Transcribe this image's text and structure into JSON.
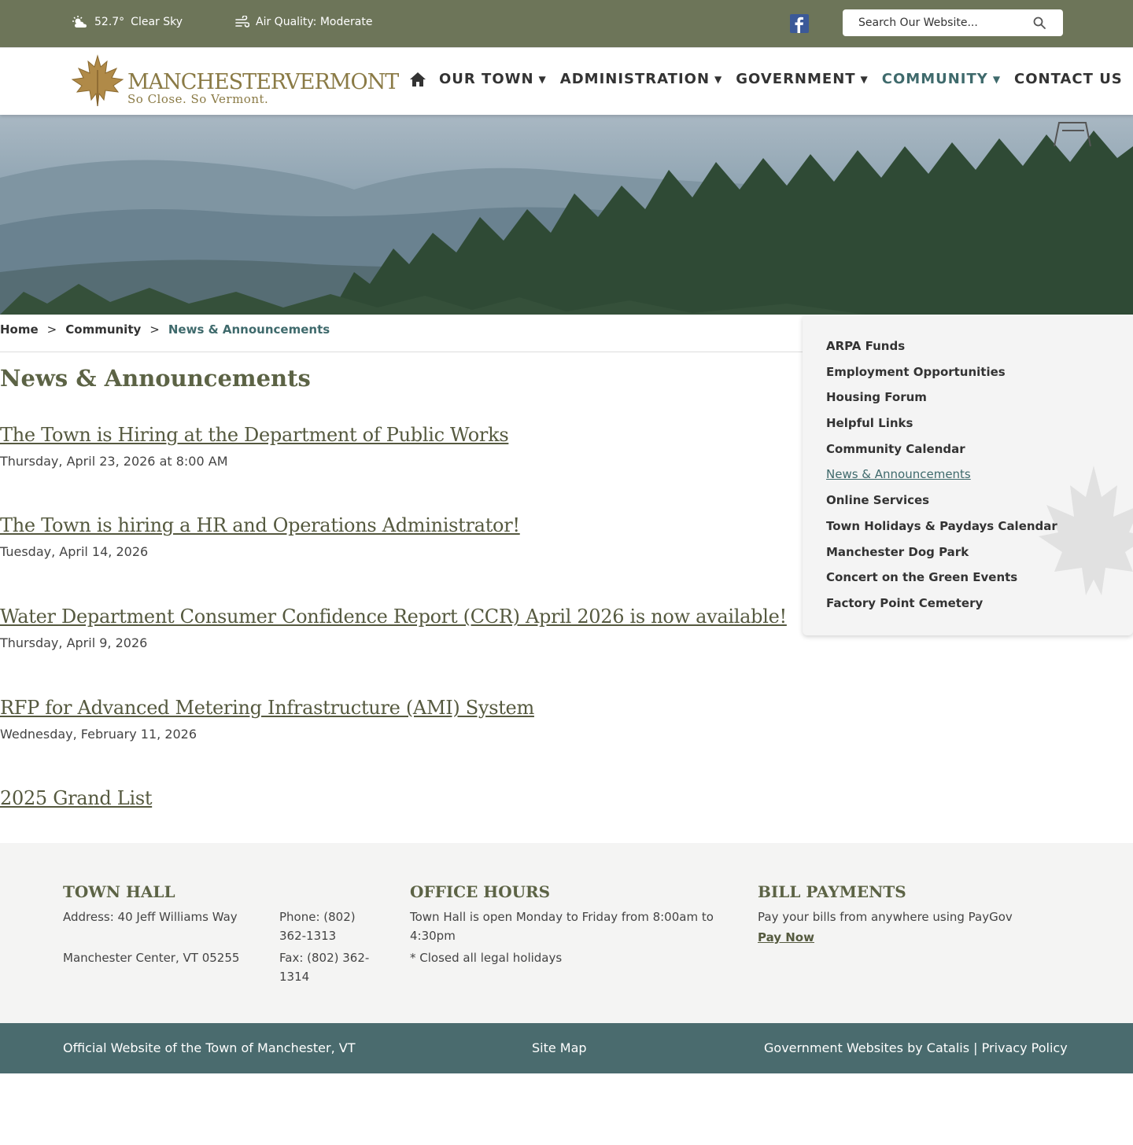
{
  "topbar": {
    "temperature": "52.7°",
    "condition": "Clear Sky",
    "air_quality": "Air Quality: Moderate",
    "search_placeholder": "Search Our Website..."
  },
  "header": {
    "logo_name": "MANCHESTERVERMONT",
    "logo_tagline": "So Close. So Vermont.",
    "nav": [
      {
        "label": "OUR TOWN",
        "caret": "▼"
      },
      {
        "label": "ADMINISTRATION",
        "caret": "▼"
      },
      {
        "label": "GOVERNMENT",
        "caret": "▼"
      },
      {
        "label": "COMMUNITY",
        "caret": "▼"
      },
      {
        "label": "CONTACT US",
        "caret": ""
      }
    ]
  },
  "breadcrumb": {
    "items": [
      "Home",
      "Community",
      "News & Announcements"
    ],
    "separator": ">"
  },
  "main": {
    "title": "News & Announcements",
    "news": [
      {
        "title": "The Town is Hiring at the Department of Public Works",
        "date": "Thursday, April 23, 2026 at 8:00 AM"
      },
      {
        "title": "The Town is hiring a HR and Operations Administrator!",
        "date": "Tuesday, April 14, 2026"
      },
      {
        "title": "Water Department Consumer Confidence Report (CCR) April 2026 is now available!",
        "date": "Thursday, April 9, 2026"
      },
      {
        "title": "RFP for Advanced Metering Infrastructure (AMI) System",
        "date": "Wednesday, February 11, 2026"
      },
      {
        "title": "2025 Grand List",
        "date": ""
      }
    ]
  },
  "sidebar": {
    "items": [
      "ARPA Funds",
      "Employment Opportunities",
      "Housing Forum",
      "Helpful Links",
      "Community Calendar",
      "News & Announcements",
      "Online Services",
      "Town Holidays & Paydays Calendar",
      "Manchester Dog Park",
      "Concert on the Green Events",
      "Factory Point Cemetery"
    ]
  },
  "footer": {
    "town_hall": {
      "title": "TOWN HALL",
      "address_line1": "Address: 40 Jeff Williams Way",
      "address_line2": "Manchester Center, VT 05255",
      "phone": "Phone: (802) 362-1313",
      "fax": "Fax: (802) 362-1314"
    },
    "office_hours": {
      "title": "OFFICE HOURS",
      "line1": "Town Hall is open Monday to Friday from 8:00am to 4:30pm",
      "line2": "* Closed all legal holidays"
    },
    "bill_payments": {
      "title": "BILL PAYMENTS",
      "text": "Pay your bills from anywhere using PayGov",
      "link": "Pay Now"
    }
  },
  "bottombar": {
    "official": "Official Website of the Town of Manchester, VT",
    "sitemap": "Site Map",
    "credits": "Government Websites by Catalis",
    "divider": "|",
    "privacy": "Privacy Policy"
  },
  "colors": {
    "topbar": "#6d7559",
    "accent": "#3f6a6c",
    "olive_text": "#5c6345",
    "footer_bar": "#4a6b6e"
  }
}
